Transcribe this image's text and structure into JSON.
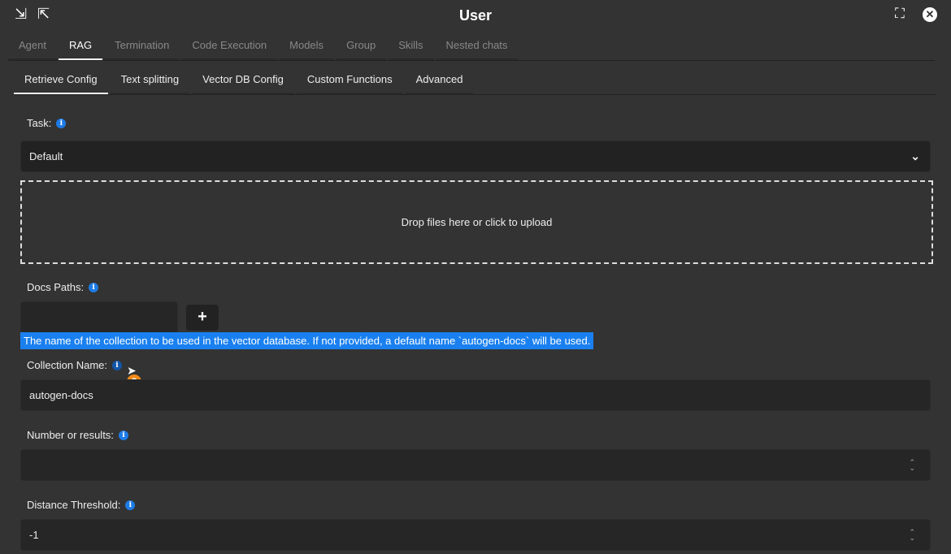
{
  "header": {
    "title": "User",
    "icons": [
      "import-icon",
      "export-icon",
      "fullscreen-icon",
      "close-icon"
    ]
  },
  "tabs": [
    "Agent",
    "RAG",
    "Termination",
    "Code Execution",
    "Models",
    "Group",
    "Skills",
    "Nested chats"
  ],
  "active_tab": "RAG",
  "subtabs": [
    "Retrieve Config",
    "Text splitting",
    "Vector DB Config",
    "Custom Functions",
    "Advanced"
  ],
  "active_subtab": "Retrieve Config",
  "form": {
    "task_label": "Task:",
    "task_value": "Default",
    "upload_text": "Drop files here or click to upload",
    "docs_paths_label": "Docs Paths:",
    "docs_paths_value": "",
    "add_label": "+",
    "tooltip": "The name of the collection to be used in the vector database. If not provided, a default name `autogen-docs` will be used.",
    "collection_label": "Collection Name:",
    "collection_value": "autogen-docs",
    "results_label": "Number or results:",
    "results_value": "",
    "distance_label": "Distance Threshold:",
    "distance_value": "-1"
  },
  "colors": {
    "accent": "#1a80f0",
    "background": "#333333",
    "field": "#262626"
  }
}
